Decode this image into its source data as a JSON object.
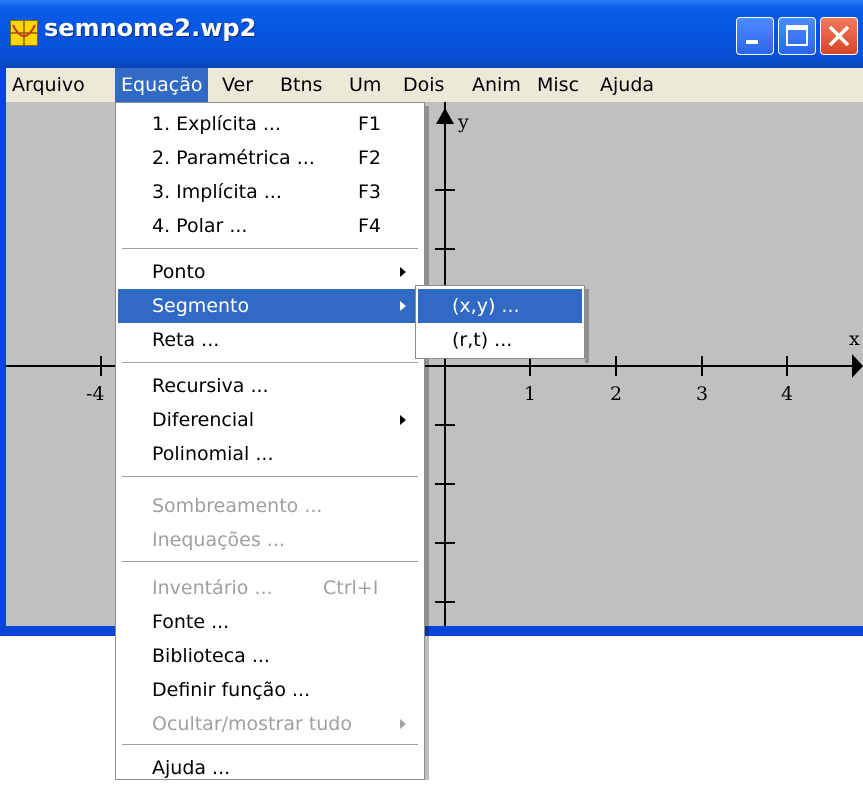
{
  "window": {
    "title": "semnome2.wp2"
  },
  "menubar": [
    "Arquivo",
    "Equação",
    "Ver",
    "Btns",
    "Um",
    "Dois",
    "Anim",
    "Misc",
    "Ajuda"
  ],
  "equacao_menu": {
    "items": [
      {
        "label": "1. Explícita ...",
        "shortcut": "F1"
      },
      {
        "label": "2. Paramétrica ...",
        "shortcut": "F2"
      },
      {
        "label": "3. Implícita ...",
        "shortcut": "F3"
      },
      {
        "label": "4. Polar ...",
        "shortcut": "F4"
      },
      {
        "label": "Ponto"
      },
      {
        "label": "Segmento"
      },
      {
        "label": "Reta ..."
      },
      {
        "label": "Recursiva ..."
      },
      {
        "label": "Diferencial"
      },
      {
        "label": "Polinomial ..."
      },
      {
        "label": "Sombreamento ..."
      },
      {
        "label": "Inequações ..."
      },
      {
        "label": "Inventário ...",
        "shortcut": "Ctrl+I"
      },
      {
        "label": "Fonte ..."
      },
      {
        "label": "Biblioteca ..."
      },
      {
        "label": "Definir função ..."
      },
      {
        "label": "Ocultar/mostrar tudo"
      },
      {
        "label": "Ajuda ..."
      }
    ]
  },
  "segmento_submenu": {
    "items": [
      "(x,y) ...",
      "(r,t) ..."
    ]
  },
  "graph": {
    "x_axis_label": "x",
    "y_axis_label": "y",
    "x_tick_labels": [
      "-4",
      "1",
      "2",
      "3",
      "4"
    ]
  },
  "colors": {
    "title_bar": "#0a54e0",
    "selection": "#316ac5",
    "plot_background": "#c0c0c0",
    "menubar": "#ece9d8"
  },
  "icons": [
    "app-icon",
    "minimize-icon",
    "maximize-icon",
    "close-icon",
    "submenu-arrow-icon"
  ]
}
